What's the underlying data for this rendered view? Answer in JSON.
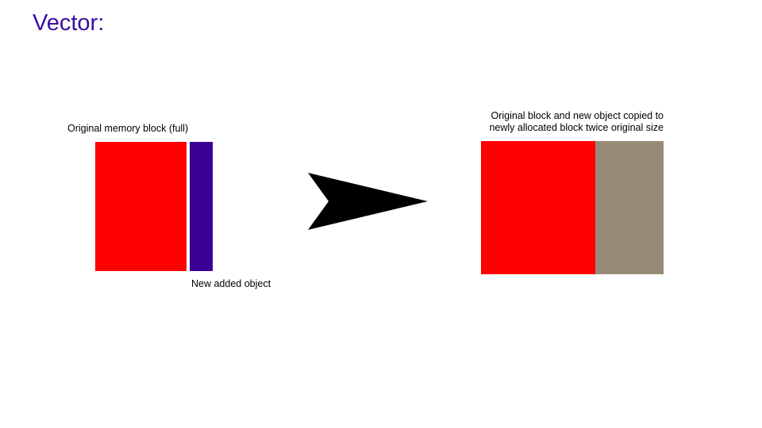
{
  "slide": {
    "title": "Vector:",
    "title_color": "#3a0ca3",
    "left_group": {
      "label": "Original memory block (full)",
      "original_block_color": "#ff0000",
      "new_object_color": "#3a0094",
      "new_object_label": "New added object"
    },
    "arrow": {
      "icon": "arrow-right-icon",
      "color": "#000000"
    },
    "right_group": {
      "label": "Original block and new object copied to newly allocated block twice original size",
      "copied_block_color": "#ff0000",
      "free_space_color": "#978a76"
    }
  }
}
